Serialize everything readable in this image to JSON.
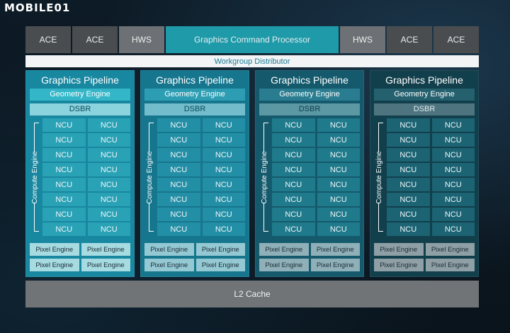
{
  "watermark": "MOBILE01",
  "top_row": [
    {
      "label": "ACE",
      "kind": "ace"
    },
    {
      "label": "ACE",
      "kind": "ace"
    },
    {
      "label": "HWS",
      "kind": "hws"
    },
    {
      "label": "Graphics Command Processor",
      "kind": "gcp"
    },
    {
      "label": "HWS",
      "kind": "hws"
    },
    {
      "label": "ACE",
      "kind": "ace"
    },
    {
      "label": "ACE",
      "kind": "ace"
    }
  ],
  "workgroup_distributor": "Workgroup Distributor",
  "pipelines": [
    {
      "title": "Graphics Pipeline",
      "geometry_engine": "Geometry Engine",
      "dsbr": "DSBR",
      "compute_engine": "Compute Engine",
      "ncus": [
        "NCU",
        "NCU",
        "NCU",
        "NCU",
        "NCU",
        "NCU",
        "NCU",
        "NCU",
        "NCU",
        "NCU",
        "NCU",
        "NCU",
        "NCU",
        "NCU",
        "NCU",
        "NCU"
      ],
      "pixel_engines": [
        "Pixel Engine",
        "Pixel Engine",
        "Pixel Engine",
        "Pixel Engine"
      ]
    },
    {
      "title": "Graphics Pipeline",
      "geometry_engine": "Geometry Engine",
      "dsbr": "DSBR",
      "compute_engine": "Compute Engine",
      "ncus": [
        "NCU",
        "NCU",
        "NCU",
        "NCU",
        "NCU",
        "NCU",
        "NCU",
        "NCU",
        "NCU",
        "NCU",
        "NCU",
        "NCU",
        "NCU",
        "NCU",
        "NCU",
        "NCU"
      ],
      "pixel_engines": [
        "Pixel Engine",
        "Pixel Engine",
        "Pixel Engine",
        "Pixel Engine"
      ]
    },
    {
      "title": "Graphics Pipeline",
      "geometry_engine": "Geometry Engine",
      "dsbr": "DSBR",
      "compute_engine": "Compute Engine",
      "ncus": [
        "NCU",
        "NCU",
        "NCU",
        "NCU",
        "NCU",
        "NCU",
        "NCU",
        "NCU",
        "NCU",
        "NCU",
        "NCU",
        "NCU",
        "NCU",
        "NCU",
        "NCU",
        "NCU"
      ],
      "pixel_engines": [
        "Pixel Engine",
        "Pixel Engine",
        "Pixel Engine",
        "Pixel Engine"
      ]
    },
    {
      "title": "Graphics Pipeline",
      "geometry_engine": "Geometry Engine",
      "dsbr": "DSBR",
      "compute_engine": "Compute Engine",
      "ncus": [
        "NCU",
        "NCU",
        "NCU",
        "NCU",
        "NCU",
        "NCU",
        "NCU",
        "NCU",
        "NCU",
        "NCU",
        "NCU",
        "NCU",
        "NCU",
        "NCU",
        "NCU",
        "NCU"
      ],
      "pixel_engines": [
        "Pixel Engine",
        "Pixel Engine",
        "Pixel Engine",
        "Pixel Engine"
      ]
    }
  ],
  "l2_cache": "L2 Cache",
  "colors": {
    "gcp": "#1e9aa8",
    "ace": "#4a4d50",
    "hws": "#6d7074",
    "l2": "#707477",
    "background": "#0b1620"
  }
}
